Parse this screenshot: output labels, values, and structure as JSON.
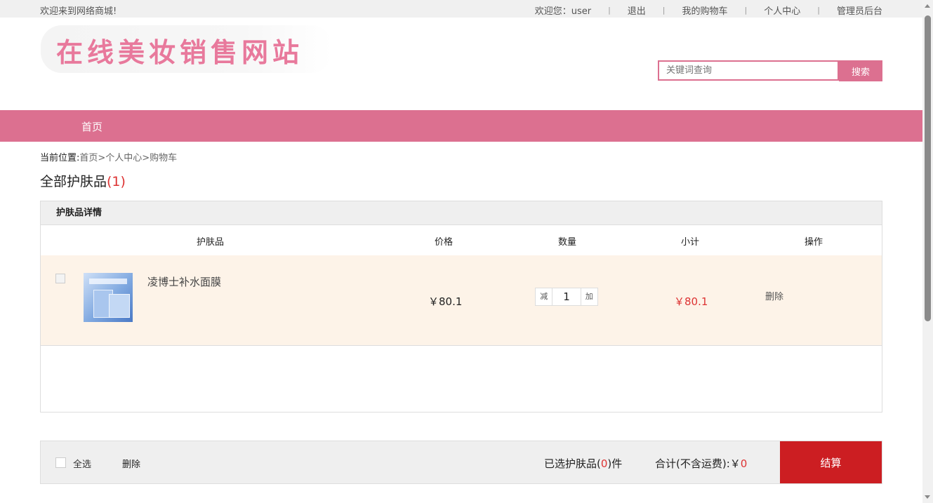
{
  "topbar": {
    "welcome": "欢迎来到网络商城!",
    "greeting": "欢迎您：user",
    "logout": "退出",
    "cart": "我的购物车",
    "profile": "个人中心",
    "admin": "管理员后台"
  },
  "logo": {
    "text": "在线美妆销售网站"
  },
  "search": {
    "placeholder": "关键词查询",
    "button": "搜索"
  },
  "nav": {
    "home": "首页"
  },
  "breadcrumb": {
    "label": "当前位置:",
    "path": "首页>个人中心>购物车"
  },
  "page": {
    "title": "全部护肤品",
    "count": "(1)"
  },
  "panel": {
    "header": "护肤品详情",
    "columns": {
      "product": "护肤品",
      "price": "价格",
      "quantity": "数量",
      "subtotal": "小计",
      "action": "操作"
    }
  },
  "items": [
    {
      "name": "凌博士补水面膜",
      "price": "￥80.1",
      "dec": "减",
      "qty": "1",
      "inc": "加",
      "subtotal": "￥80.1",
      "delete": "删除"
    }
  ],
  "footer": {
    "select_all": "全选",
    "delete": "删除",
    "selected_prefix": "已选护肤品(",
    "selected_n": "0",
    "selected_suffix": ")件",
    "total_label": "合计(不含运费):￥",
    "total_n": "0",
    "checkout": "结算"
  },
  "colors": {
    "brand": "#dc7090",
    "accent": "#cc1e22",
    "price_red": "#dd3333"
  }
}
